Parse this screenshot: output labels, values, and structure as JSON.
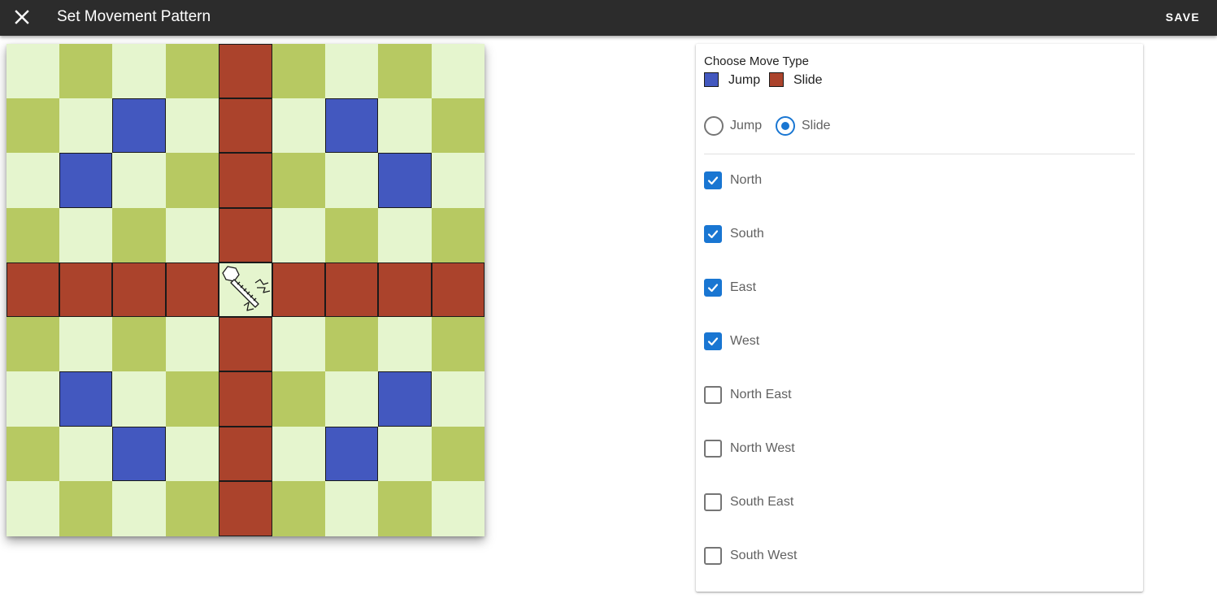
{
  "appbar": {
    "title": "Set Movement Pattern",
    "save_label": "SAVE",
    "close_icon": "close-icon",
    "background": "#2c2c2c"
  },
  "board": {
    "rows": 9,
    "cols": 9,
    "colors": {
      "light": "#e5f5ce",
      "dark": "#b7c962",
      "jump": "#4358bf",
      "slide": "#ab432c"
    },
    "piece": {
      "row": 4,
      "col": 4,
      "icon": "bishop-piece-icon"
    },
    "jump_squares": [
      [
        1,
        2
      ],
      [
        1,
        6
      ],
      [
        2,
        1
      ],
      [
        2,
        7
      ],
      [
        6,
        1
      ],
      [
        6,
        7
      ],
      [
        7,
        2
      ],
      [
        7,
        6
      ]
    ],
    "slide_squares": [
      [
        0,
        4
      ],
      [
        1,
        4
      ],
      [
        2,
        4
      ],
      [
        3,
        4
      ],
      [
        5,
        4
      ],
      [
        6,
        4
      ],
      [
        7,
        4
      ],
      [
        8,
        4
      ],
      [
        4,
        0
      ],
      [
        4,
        1
      ],
      [
        4,
        2
      ],
      [
        4,
        3
      ],
      [
        4,
        5
      ],
      [
        4,
        6
      ],
      [
        4,
        7
      ],
      [
        4,
        8
      ]
    ]
  },
  "panel": {
    "title": "Choose Move Type",
    "legend": [
      {
        "label": "Jump",
        "color": "#4358bf"
      },
      {
        "label": "Slide",
        "color": "#ab432c"
      }
    ],
    "move_types": [
      {
        "label": "Jump",
        "selected": false
      },
      {
        "label": "Slide",
        "selected": true
      }
    ],
    "accent": "#1976d2",
    "directions": [
      {
        "label": "North",
        "checked": true
      },
      {
        "label": "South",
        "checked": true
      },
      {
        "label": "East",
        "checked": true
      },
      {
        "label": "West",
        "checked": true
      },
      {
        "label": "North East",
        "checked": false
      },
      {
        "label": "North West",
        "checked": false
      },
      {
        "label": "South East",
        "checked": false
      },
      {
        "label": "South West",
        "checked": false
      }
    ]
  }
}
